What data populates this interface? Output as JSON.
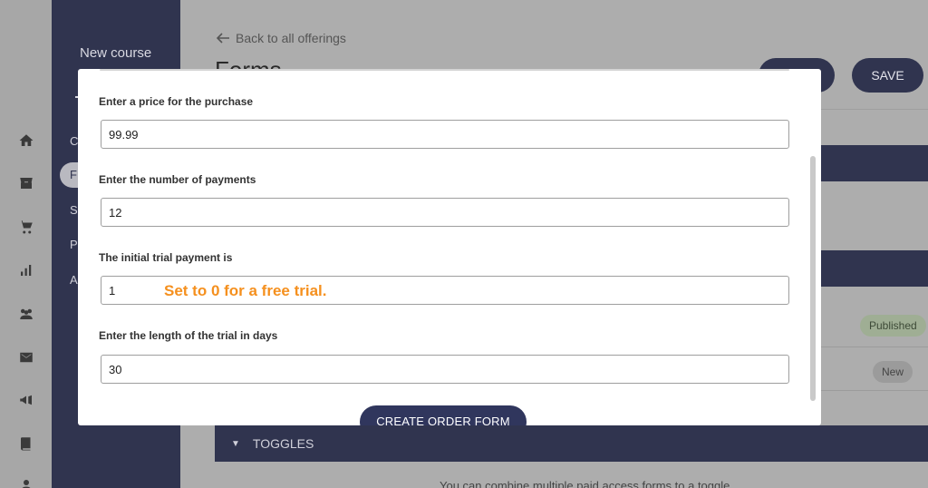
{
  "sidebar": {
    "icons": [
      "home-icon",
      "store-icon",
      "cart-icon",
      "chart-icon",
      "community-icon",
      "mail-icon",
      "megaphone-icon",
      "book-icon",
      "user-icon"
    ]
  },
  "nav": {
    "title": "New course",
    "items": [
      {
        "label": "C"
      },
      {
        "label": "F",
        "active": true
      },
      {
        "label": "S"
      },
      {
        "label": "P"
      },
      {
        "label": "A"
      }
    ]
  },
  "header": {
    "back_label": "Back to all offerings",
    "title": "Forms",
    "save_label": "SAVE"
  },
  "background": {
    "published_badge": "Published",
    "new_badge": "New",
    "toggles_label": "TOGGLES",
    "toggles_text": "You can combine multiple paid access forms to a toggle"
  },
  "modal": {
    "fields": [
      {
        "label": "Enter a price for the purchase",
        "value": "99.99"
      },
      {
        "label": "Enter the number of payments",
        "value": "12"
      },
      {
        "label": "The initial trial payment is",
        "value": "1"
      },
      {
        "label": "Enter the length of the trial in days",
        "value": "30"
      }
    ],
    "submit_label": "CREATE ORDER FORM"
  },
  "annotation": {
    "text": "Set to 0 for a free trial.",
    "color": "#f5901e"
  },
  "colors": {
    "brand_dark": "#30344f",
    "overlay": "#a9a9a9"
  }
}
